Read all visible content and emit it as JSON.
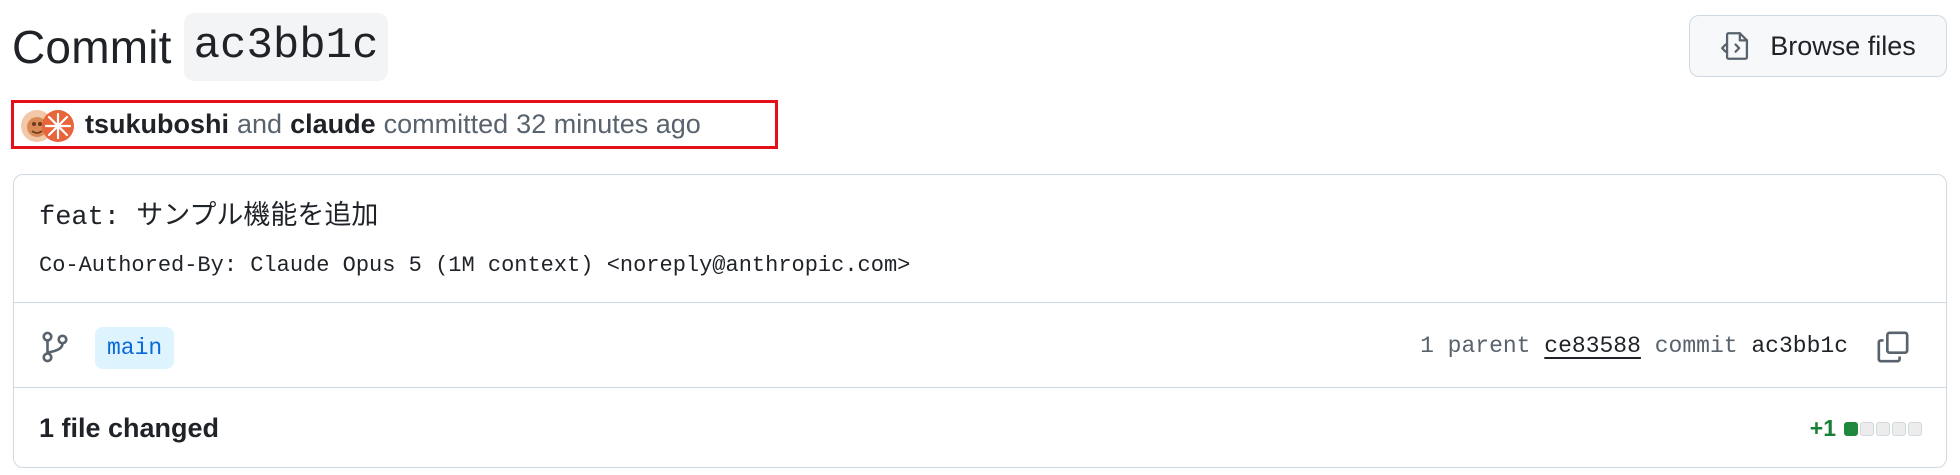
{
  "header": {
    "title_word": "Commit",
    "title_sha": "ac3bb1c",
    "browse_label": "Browse files"
  },
  "author_line": {
    "author1": "tsukuboshi",
    "joiner": "and",
    "author2": "claude",
    "action": "committed",
    "time": "32 minutes ago",
    "highlight_color": "#e3101a"
  },
  "commit": {
    "message_title": "feat: サンプル機能を追加",
    "message_body": "Co-Authored-By: Claude Opus 5 (1M context) <noreply@anthropic.com>",
    "branch": "main",
    "parent_count_label": "1 parent",
    "parent_sha": "ce83588",
    "commit_label": "commit",
    "commit_sha": "ac3bb1c"
  },
  "files": {
    "changed_label": "1 file changed",
    "additions": "+1",
    "diff_blocks": [
      "added",
      "neutral",
      "neutral",
      "neutral",
      "neutral"
    ]
  },
  "icons": {
    "browse": "file-code-icon",
    "branch": "git-branch-icon",
    "copy": "copy-icon"
  },
  "colors": {
    "accent_blue": "#0969da",
    "branch_bg": "#ddf4ff",
    "addition_green": "#1a7f37"
  }
}
